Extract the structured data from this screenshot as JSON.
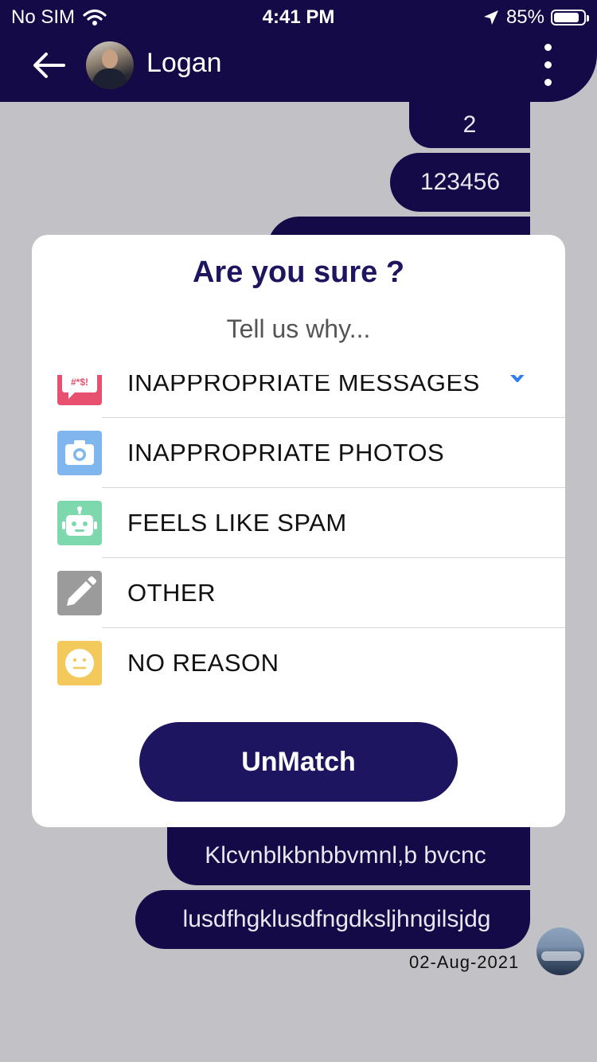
{
  "status_bar": {
    "carrier": "No SIM",
    "time": "4:41 PM",
    "battery_percent": "85%",
    "battery_level": 0.85
  },
  "header": {
    "contact_name": "Logan",
    "back_icon": "back-arrow-icon",
    "menu_icon": "vertical-dots-icon"
  },
  "messages": [
    {
      "text": "2"
    },
    {
      "text": "123456"
    },
    {
      "text": ""
    },
    {
      "text": "Klcvnblkbnbbvmnl,b bvcnc"
    },
    {
      "text": "lusdfhgklusdfngdksljhngilsjdg"
    }
  ],
  "message_date": "02-Aug-2021",
  "dialog": {
    "title": "Are you sure  ?",
    "subtitle": "Tell us why...",
    "reasons": [
      {
        "label": "INAPPROPRIATE MESSAGES",
        "icon": "speech-bubble-icon",
        "color": "#e8506f",
        "selected": true
      },
      {
        "label": "INAPPROPRIATE PHOTOS",
        "icon": "camera-icon",
        "color": "#7fb6ee",
        "selected": false
      },
      {
        "label": "FEELS LIKE SPAM",
        "icon": "robot-icon",
        "color": "#7dd8ad",
        "selected": false
      },
      {
        "label": "OTHER",
        "icon": "pencil-icon",
        "color": "#9b9b9b",
        "selected": false
      },
      {
        "label": "NO REASON",
        "icon": "neutral-face-icon",
        "color": "#f2c95a",
        "selected": false
      }
    ],
    "button_label": "UnMatch"
  },
  "colors": {
    "primary": "#130a47",
    "button": "#1e1560",
    "check": "#2f7cf6",
    "backdrop": "#c2c2c6"
  }
}
